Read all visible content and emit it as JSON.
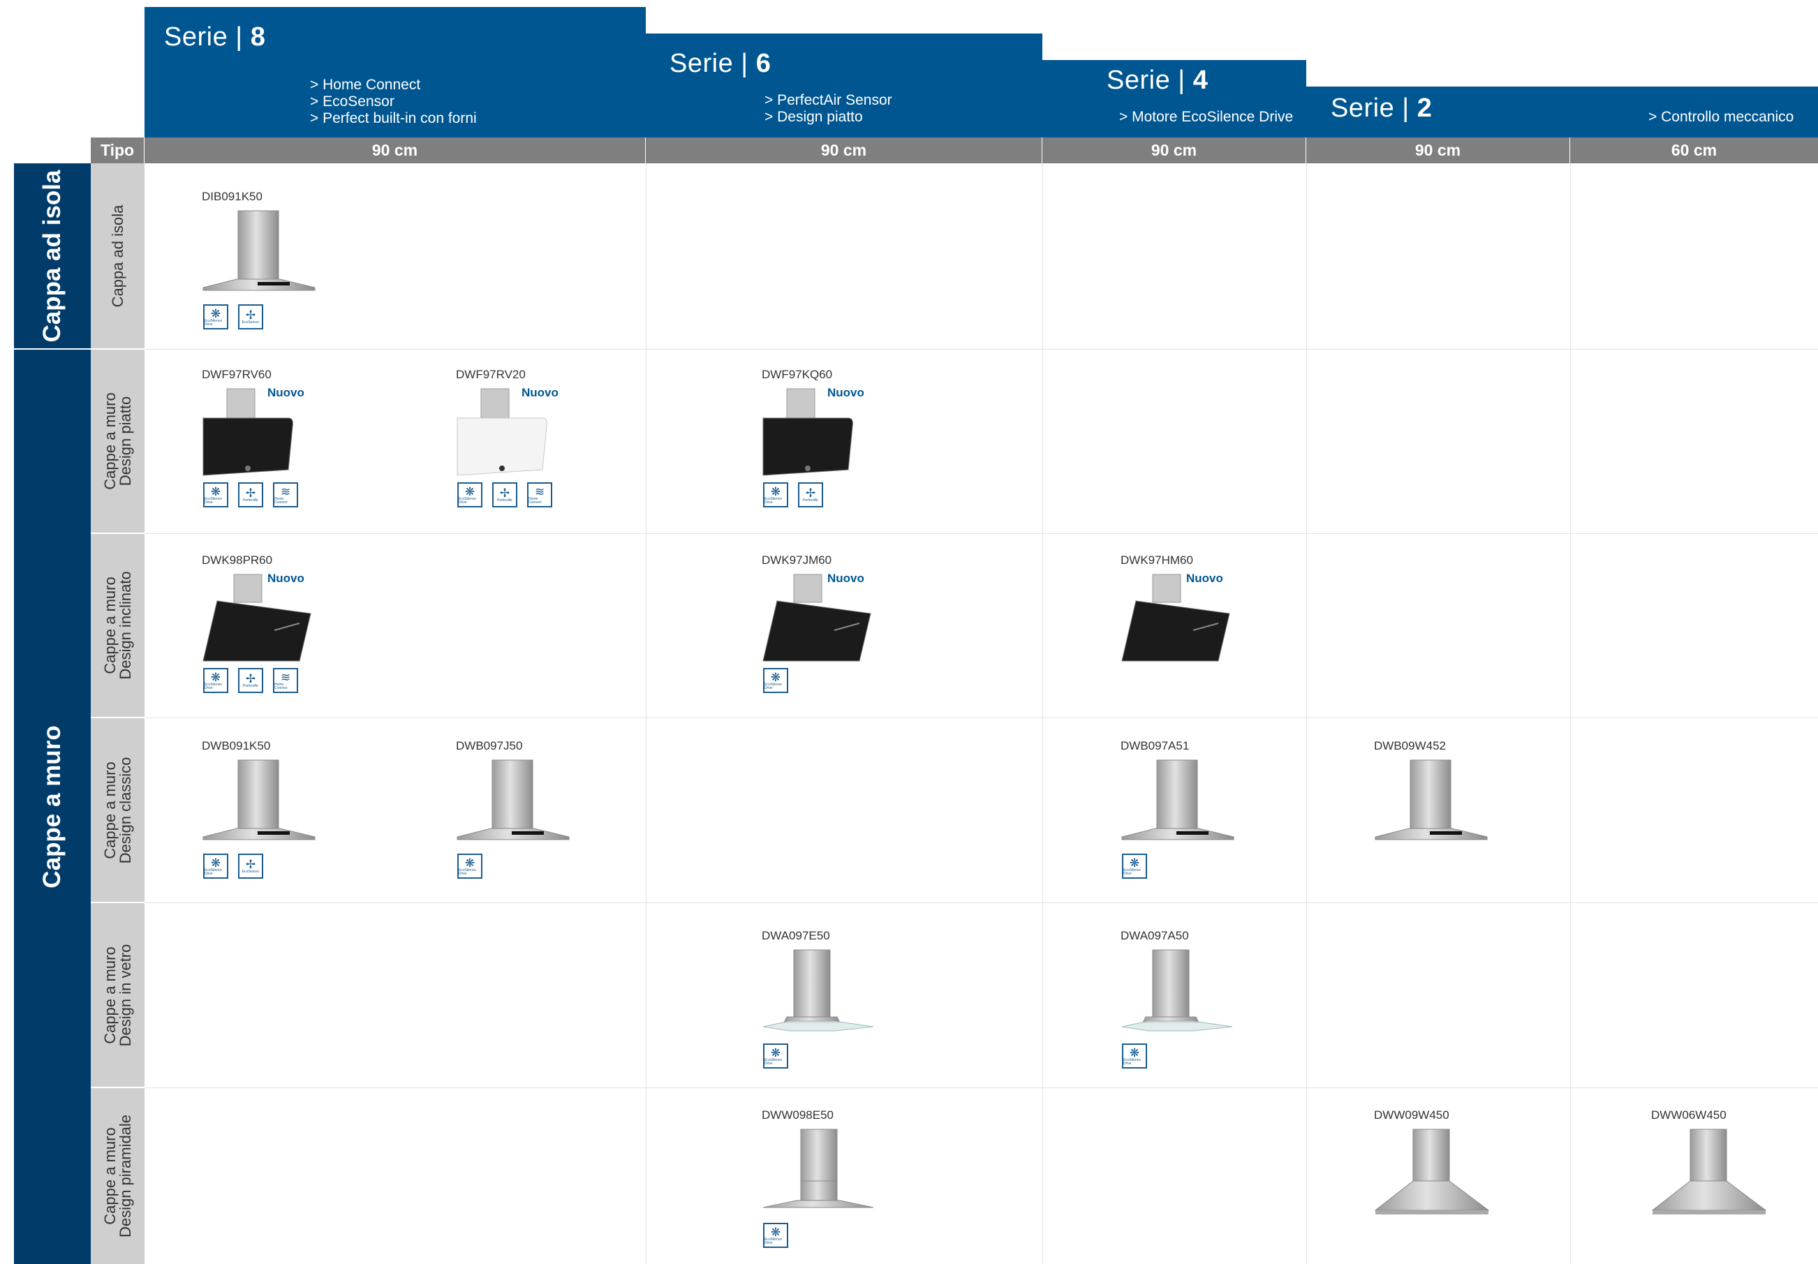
{
  "series": [
    {
      "word": "Serie | ",
      "num": "8",
      "features": [
        "> Home Connect",
        "> EcoSensor",
        "> Perfect built-in con forni"
      ]
    },
    {
      "word": "Serie | ",
      "num": "6",
      "features": [
        "> PerfectAir Sensor",
        "> Design piatto"
      ]
    },
    {
      "word": "Serie | ",
      "num": "4",
      "features": [
        "> Motore EcoSilence Drive"
      ]
    },
    {
      "word": "Serie | ",
      "num": "2",
      "features": [
        "> Controllo meccanico"
      ]
    }
  ],
  "tipo_label": "Tipo",
  "sizes": [
    "90 cm",
    "90 cm",
    "90 cm",
    "90 cm",
    "60 cm"
  ],
  "groups": [
    "Cappa ad isola",
    "Cappe a muro"
  ],
  "types": [
    [
      "Cappa ad isola"
    ],
    [
      "Cappe a muro",
      "Design piatto"
    ],
    [
      "Cappe a muro",
      "Design inclinato"
    ],
    [
      "Cappe a muro",
      "Design classico"
    ],
    [
      "Cappe a muro",
      "Design in vetro"
    ],
    [
      "Cappe a muro",
      "Design piramidale"
    ]
  ],
  "new_label": "Nuovo",
  "badge_labels": {
    "ecosilence": "EcoSilence Drive",
    "ecosensor": "EcoSensor",
    "perfectair": "PerfectAir",
    "homeconnect": "Home Connect"
  },
  "badge_icons": {
    "ecosilence": "fan-blades-icon",
    "ecosensor": "fan-icon",
    "perfectair": "fan-icon",
    "homeconnect": "wifi-icon"
  },
  "brand_colors": {
    "series_blue": "#005691",
    "group_navy": "#003b6a",
    "size_bar_gray": "#7f7f7f",
    "type_gray": "#cfcfcf"
  },
  "products": {
    "DIB091K50": {
      "code": "DIB091K50",
      "nuovo": false,
      "badges": [
        "ecosilence",
        "ecosensor"
      ],
      "style": "island",
      "color": "steel"
    },
    "DWF97RV60": {
      "code": "DWF97RV60",
      "nuovo": true,
      "badges": [
        "ecosilence",
        "perfectair",
        "homeconnect"
      ],
      "style": "flat",
      "color": "black"
    },
    "DWF97RV20": {
      "code": "DWF97RV20",
      "nuovo": true,
      "badges": [
        "ecosilence",
        "perfectair",
        "homeconnect"
      ],
      "style": "flat",
      "color": "white"
    },
    "DWF97KQ60": {
      "code": "DWF97KQ60",
      "nuovo": true,
      "badges": [
        "ecosilence",
        "perfectair"
      ],
      "style": "flat",
      "color": "black"
    },
    "DWK98PR60": {
      "code": "DWK98PR60",
      "nuovo": true,
      "badges": [
        "ecosilence",
        "perfectair",
        "homeconnect"
      ],
      "style": "inclined",
      "color": "black"
    },
    "DWK97JM60": {
      "code": "DWK97JM60",
      "nuovo": true,
      "badges": [
        "ecosilence"
      ],
      "style": "inclined",
      "color": "black"
    },
    "DWK97HM60": {
      "code": "DWK97HM60",
      "nuovo": true,
      "badges": [],
      "style": "inclined",
      "color": "black"
    },
    "DWB091K50": {
      "code": "DWB091K50",
      "nuovo": false,
      "badges": [
        "ecosilence",
        "ecosensor"
      ],
      "style": "chimney",
      "color": "steel"
    },
    "DWB097J50": {
      "code": "DWB097J50",
      "nuovo": false,
      "badges": [
        "ecosilence"
      ],
      "style": "chimney",
      "color": "steel"
    },
    "DWB097A51": {
      "code": "DWB097A51",
      "nuovo": false,
      "badges": [
        "ecosilence"
      ],
      "style": "chimney",
      "color": "steel"
    },
    "DWB09W452": {
      "code": "DWB09W452",
      "nuovo": false,
      "badges": [],
      "style": "chimney",
      "color": "steel"
    },
    "DWA097E50": {
      "code": "DWA097E50",
      "nuovo": false,
      "badges": [
        "ecosilence"
      ],
      "style": "glass",
      "color": "steel"
    },
    "DWA097A50": {
      "code": "DWA097A50",
      "nuovo": false,
      "badges": [
        "ecosilence"
      ],
      "style": "glass",
      "color": "steel"
    },
    "DWW098E50": {
      "code": "DWW098E50",
      "nuovo": false,
      "badges": [
        "ecosilence"
      ],
      "style": "pyramid-flat",
      "color": "steel"
    },
    "DWW09W450": {
      "code": "DWW09W450",
      "nuovo": false,
      "badges": [],
      "style": "pyramid",
      "color": "steel"
    },
    "DWW06W450": {
      "code": "DWW06W450",
      "nuovo": false,
      "badges": [],
      "style": "pyramid",
      "color": "steel"
    }
  }
}
